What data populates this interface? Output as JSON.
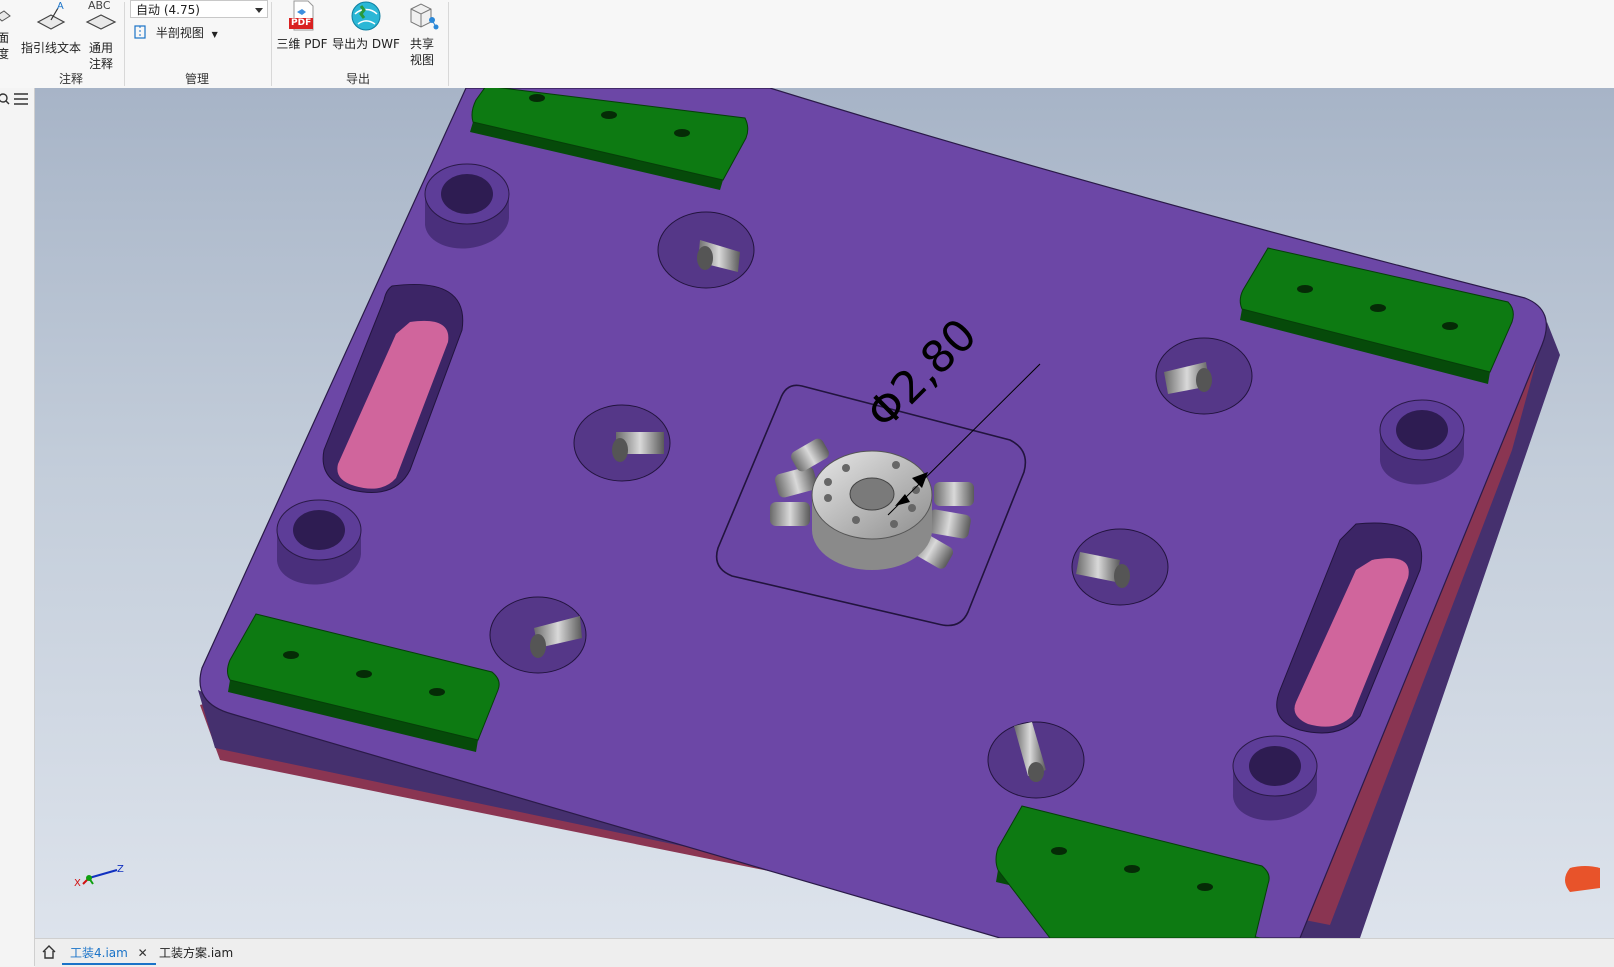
{
  "ribbon": {
    "partial_button_label_line1": "面",
    "partial_button_label_line2": "度",
    "leader_text_label": "指引线文本",
    "general_note_label_line1": "通用",
    "general_note_label_line2": "注释",
    "general_note_icon_text": "ABC",
    "annotation_group_label": "注释",
    "scale_combo_value": "自动 (4.75)",
    "half_section_label": "半剖视图",
    "manage_group_label": "管理",
    "pdf_label": "三维 PDF",
    "pdf_icon_text": "PDF",
    "dwf_label": "导出为 DWF",
    "share_label_line1": "共享",
    "share_label_line2": "视图",
    "export_group_label": "导出"
  },
  "viewport": {
    "dimension_text": "Φ2,80",
    "axis_x": "X",
    "axis_z": "Z"
  },
  "tabs": [
    {
      "label": "工装4.iam",
      "active": true
    },
    {
      "label": "工装方案.iam",
      "active": false
    }
  ],
  "colors": {
    "plate": "#6c47a6",
    "fixture_green": "#0d7a12",
    "slot_pink": "#d0659c",
    "accent": "#1a73c8"
  }
}
